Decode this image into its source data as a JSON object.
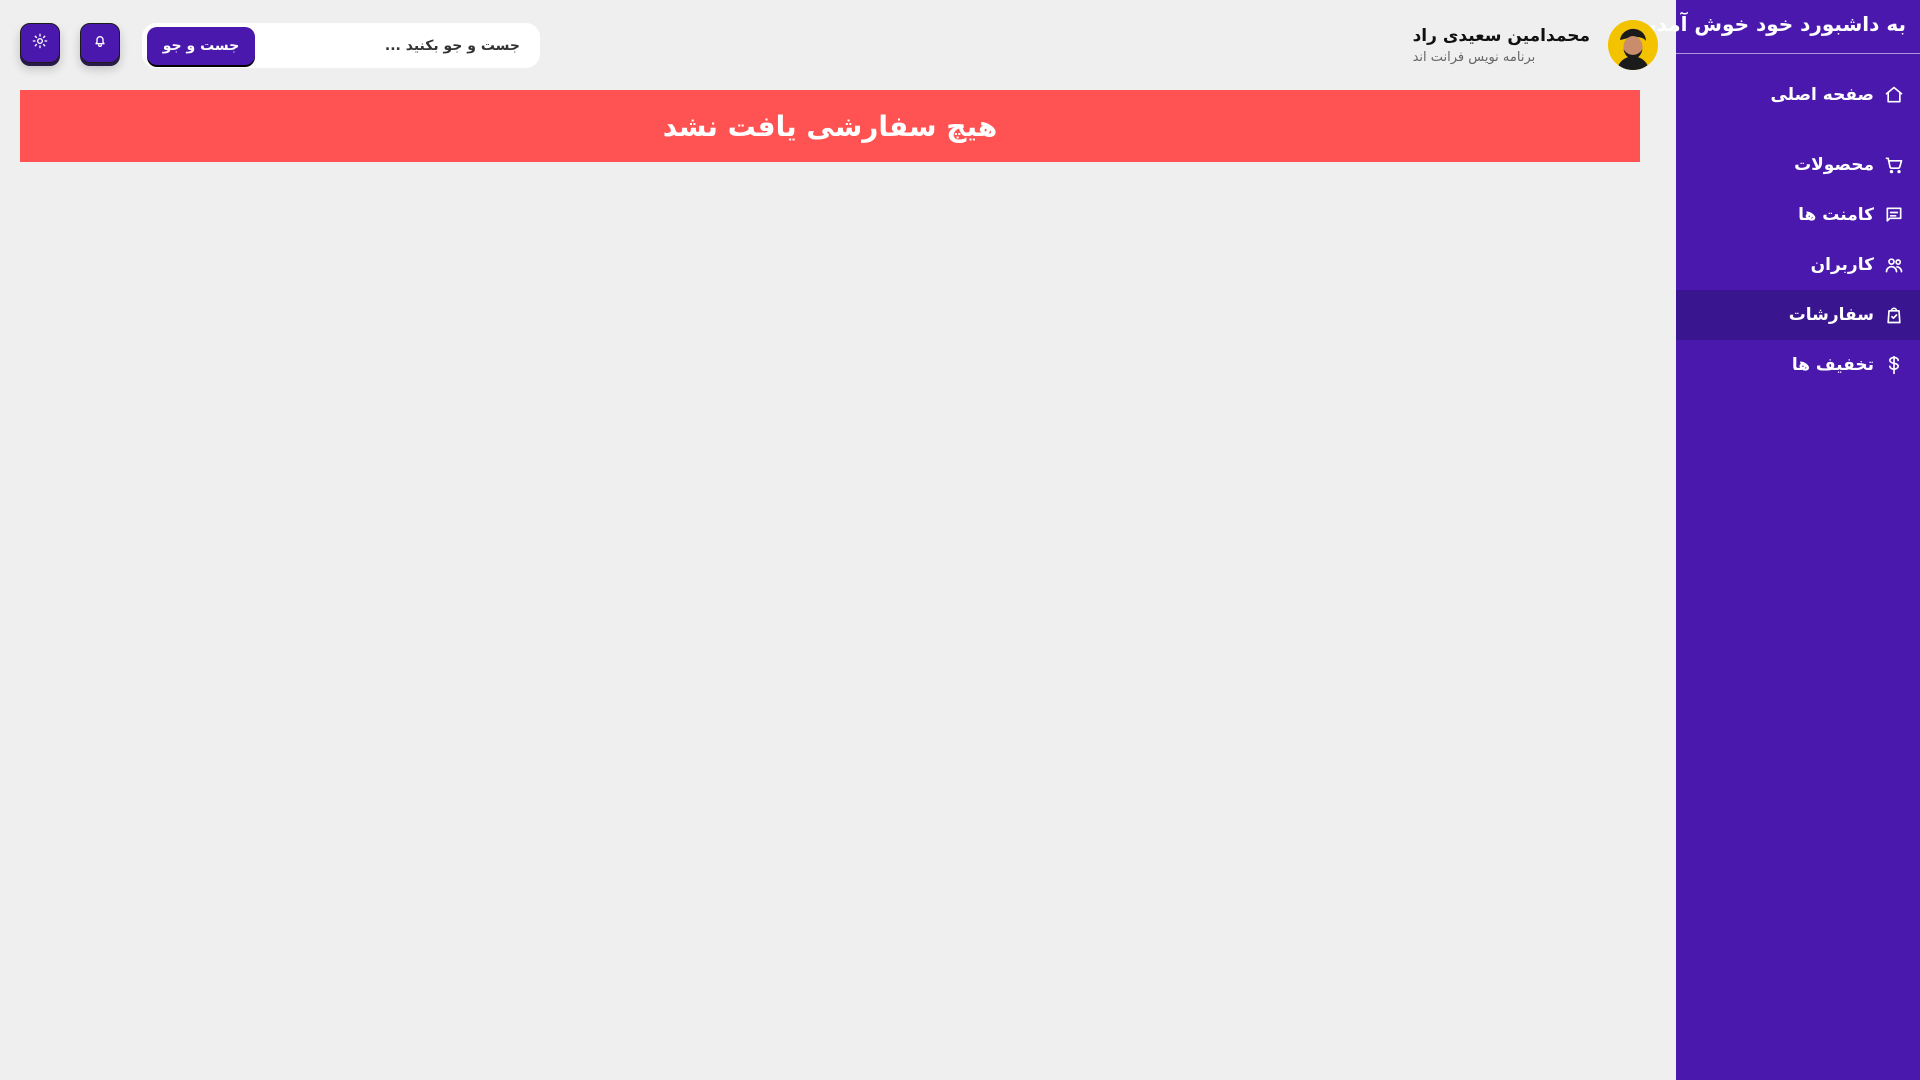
{
  "colors": {
    "background": "#efefef",
    "sidebar": "#4a18ad",
    "sidebar_active": "#3a1590",
    "accent": "#4a18ad",
    "alert": "#ff5252"
  },
  "sidebar": {
    "title": "به داشبورد خود خوش آمدید",
    "items": [
      {
        "label": "صفحه اصلی",
        "icon": "home-icon",
        "active": false
      },
      {
        "label": "محصولات",
        "icon": "cart-icon",
        "active": false
      },
      {
        "label": "کامنت ها",
        "icon": "comment-icon",
        "active": false
      },
      {
        "label": "کاربران",
        "icon": "users-icon",
        "active": false
      },
      {
        "label": "سفارشات",
        "icon": "bag-check-icon",
        "active": true
      },
      {
        "label": "تخفیف ها",
        "icon": "dollar-icon",
        "active": false
      }
    ]
  },
  "header": {
    "user": {
      "name": "محمدامین سعیدی راد",
      "role": "برنامه نویس فرانت اند",
      "avatar_icon": "avatar"
    },
    "search": {
      "placeholder": "جست و جو بکنید ...",
      "button_label": "جست و جو"
    },
    "icons": {
      "notifications": "bell-icon",
      "theme": "sun-icon"
    }
  },
  "main": {
    "alert_message": "هیچ سفارشی یافت نشد"
  }
}
